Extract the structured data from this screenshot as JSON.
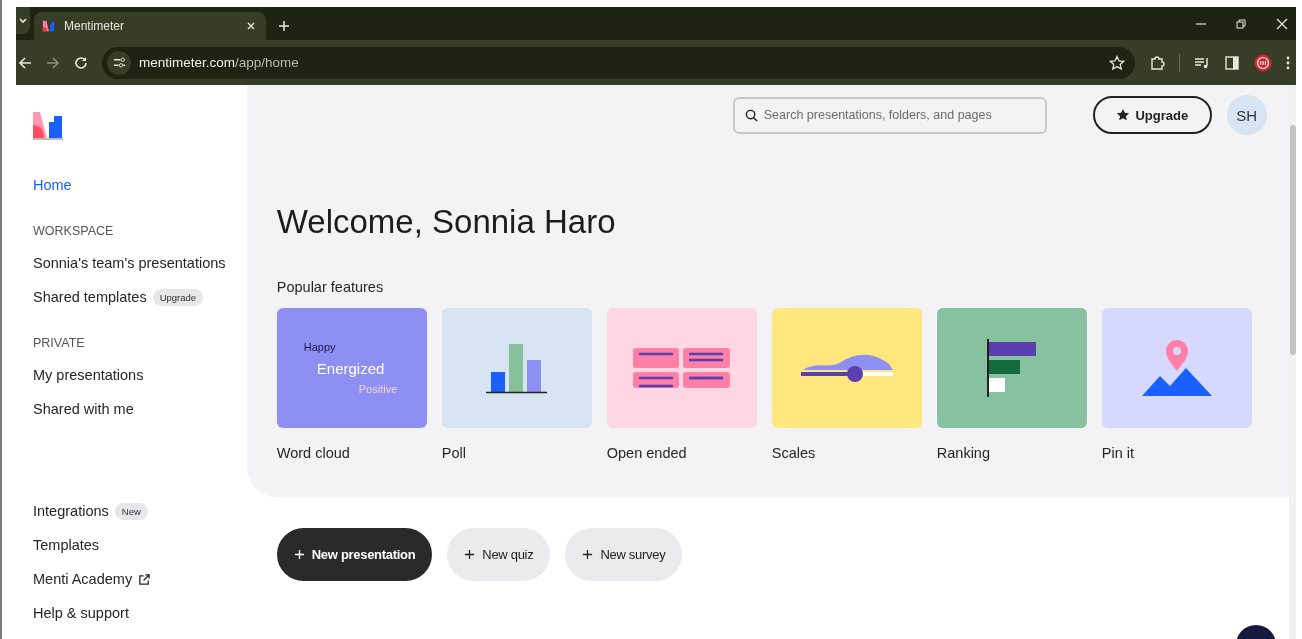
{
  "browser": {
    "tab_title": "Mentimeter",
    "address_host": "mentimeter.com",
    "address_path": "/app/home"
  },
  "sidebar": {
    "items": [
      {
        "kind": "link",
        "label": "Home",
        "selected": true
      },
      {
        "kind": "heading",
        "label": "WORKSPACE"
      },
      {
        "kind": "link",
        "label": "Sonnia's team's presentations",
        "selected": false
      },
      {
        "kind": "link",
        "label": "Shared templates",
        "badge": "Upgrade",
        "selected": false
      },
      {
        "kind": "heading",
        "label": "PRIVATE"
      },
      {
        "kind": "link",
        "label": "My presentations",
        "selected": false
      },
      {
        "kind": "link",
        "label": "Shared with me",
        "selected": false
      }
    ],
    "footer": [
      {
        "label": "Integrations",
        "badge": "New"
      },
      {
        "label": "Templates"
      },
      {
        "label": "Menti Academy",
        "external": true
      },
      {
        "label": "Help & support"
      }
    ]
  },
  "header": {
    "search_placeholder": "Search presentations, folders, and pages",
    "upgrade": "Upgrade",
    "avatar": "SH"
  },
  "welcome": "Welcome, Sonnia Haro",
  "features_title": "Popular features",
  "features": [
    {
      "kind": "wordcloud",
      "label": "Word cloud",
      "words": [
        "Happy",
        "Energized",
        "Positive"
      ]
    },
    {
      "kind": "poll",
      "label": "Poll"
    },
    {
      "kind": "open",
      "label": "Open ended"
    },
    {
      "kind": "scales",
      "label": "Scales"
    },
    {
      "kind": "ranking",
      "label": "Ranking"
    },
    {
      "kind": "pin",
      "label": "Pin it"
    }
  ],
  "actions": [
    {
      "kind": "primary",
      "label": "New presentation"
    },
    {
      "kind": "secondary",
      "label": "New quiz"
    },
    {
      "kind": "secondary",
      "label": "New survey"
    }
  ]
}
